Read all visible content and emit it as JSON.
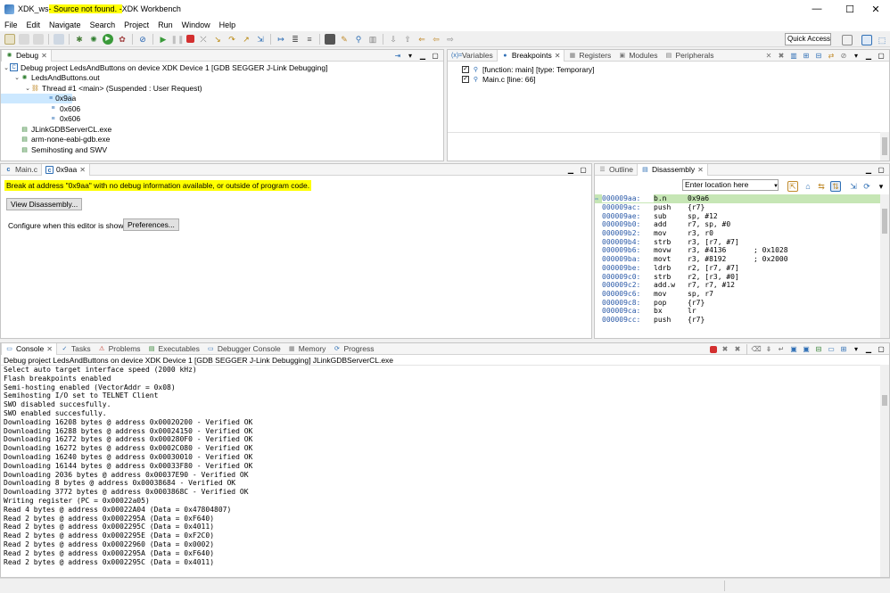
{
  "window": {
    "title_prefix": "XDK_ws",
    "title_highlight": " - Source not found. - ",
    "title_suffix": "XDK Workbench",
    "minimize": "—",
    "maximize": "☐",
    "close": "✕"
  },
  "menu": [
    "File",
    "Edit",
    "Navigate",
    "Search",
    "Project",
    "Run",
    "Window",
    "Help"
  ],
  "toolbar": {
    "quick_access": "Quick Access"
  },
  "debug_view": {
    "tab_label": "Debug",
    "tree": [
      {
        "label": "Debug project LedsAndButtons on device XDK Device 1 [GDB SEGGER J-Link Debugging]"
      },
      {
        "label": "LedsAndButtons.out"
      },
      {
        "label": "Thread #1 <main> (Suspended : User Request)"
      },
      {
        "label": "0x9aa"
      },
      {
        "label": "0x606"
      },
      {
        "label": "0x606"
      },
      {
        "label": "JLinkGDBServerCL.exe"
      },
      {
        "label": "arm-none-eabi-gdb.exe"
      },
      {
        "label": "Semihosting and SWV"
      }
    ]
  },
  "breakpoints_view": {
    "tabs": [
      "Variables",
      "Breakpoints",
      "Registers",
      "Modules",
      "Peripherals"
    ],
    "items": [
      {
        "label": "[function: main] [type: Temporary]",
        "checked": true
      },
      {
        "label": "Main.c [line: 66]",
        "checked": true
      }
    ]
  },
  "editor": {
    "tabs": [
      "Main.c",
      "0x9aa"
    ],
    "message": "Break at address \"0x9aa\" with no debug information available, or outside of program code.",
    "view_disassembly": "View Disassembly...",
    "configure_label": "Configure when this editor is shown",
    "preferences": "Preferences..."
  },
  "disassembly_view": {
    "tabs": [
      "Outline",
      "Disassembly"
    ],
    "location_placeholder": "Enter location here",
    "rows": [
      {
        "addr": "000009aa:",
        "op": "b.n",
        "args": "0x9a6",
        "comment": ""
      },
      {
        "addr": "000009ac:",
        "op": "push",
        "args": "{r7}",
        "comment": ""
      },
      {
        "addr": "000009ae:",
        "op": "sub",
        "args": "sp, #12",
        "comment": ""
      },
      {
        "addr": "000009b0:",
        "op": "add",
        "args": "r7, sp, #0",
        "comment": ""
      },
      {
        "addr": "000009b2:",
        "op": "mov",
        "args": "r3, r0",
        "comment": ""
      },
      {
        "addr": "000009b4:",
        "op": "strb",
        "args": "r3, [r7, #7]",
        "comment": ""
      },
      {
        "addr": "000009b6:",
        "op": "movw",
        "args": "r3, #4136",
        "comment": "; 0x1028"
      },
      {
        "addr": "000009ba:",
        "op": "movt",
        "args": "r3, #8192",
        "comment": "; 0x2000"
      },
      {
        "addr": "000009be:",
        "op": "ldrb",
        "args": "r2, [r7, #7]",
        "comment": ""
      },
      {
        "addr": "000009c0:",
        "op": "strb",
        "args": "r2, [r3, #0]",
        "comment": ""
      },
      {
        "addr": "000009c2:",
        "op": "add.w",
        "args": "r7, r7, #12",
        "comment": ""
      },
      {
        "addr": "000009c6:",
        "op": "mov",
        "args": "sp, r7",
        "comment": ""
      },
      {
        "addr": "000009c8:",
        "op": "pop",
        "args": "{r7}",
        "comment": ""
      },
      {
        "addr": "000009ca:",
        "op": "bx",
        "args": "lr",
        "comment": ""
      },
      {
        "addr": "000009cc:",
        "op": "push",
        "args": "{r7}",
        "comment": ""
      }
    ]
  },
  "console_view": {
    "tabs": [
      "Console",
      "Tasks",
      "Problems",
      "Executables",
      "Debugger Console",
      "Memory",
      "Progress"
    ],
    "path": "Debug project LedsAndButtons on device XDK Device 1 [GDB SEGGER J-Link Debugging] JLinkGDBServerCL.exe",
    "lines": [
      "Select auto target interface speed (2000 kHz)",
      "Flash breakpoints enabled",
      "Semi-hosting enabled (VectorAddr = 0x08)",
      "Semihosting I/O set to TELNET Client",
      "SWO disabled succesfully.",
      "SWO enabled succesfully.",
      "Downloading 16208 bytes @ address 0x00020200 - Verified OK",
      "Downloading 16288 bytes @ address 0x00024150 - Verified OK",
      "Downloading 16272 bytes @ address 0x000280F0 - Verified OK",
      "Downloading 16272 bytes @ address 0x0002C080 - Verified OK",
      "Downloading 16240 bytes @ address 0x00030010 - Verified OK",
      "Downloading 16144 bytes @ address 0x00033F80 - Verified OK",
      "Downloading 2036 bytes @ address 0x00037E90 - Verified OK",
      "Downloading 8 bytes @ address 0x00038684 - Verified OK",
      "Downloading 3772 bytes @ address 0x0003868C - Verified OK",
      "Writing register (PC = 0x00022a05)",
      "Read 4 bytes @ address 0x00022A04 (Data = 0x47804807)",
      "Read 2 bytes @ address 0x0002295A (Data = 0xF640)",
      "Read 2 bytes @ address 0x0002295C (Data = 0x4011)",
      "Read 2 bytes @ address 0x0002295E (Data = 0xF2C0)",
      "Read 2 bytes @ address 0x00022960 (Data = 0x0002)",
      "Read 2 bytes @ address 0x0002295A (Data = 0xF640)",
      "Read 2 bytes @ address 0x0002295C (Data = 0x4011)"
    ]
  },
  "colors": {
    "highlight_yellow": "#ffff00",
    "current_instruction": "#c6e6b5",
    "selection": "#cce8ff",
    "address_blue": "#2b5aa8"
  }
}
